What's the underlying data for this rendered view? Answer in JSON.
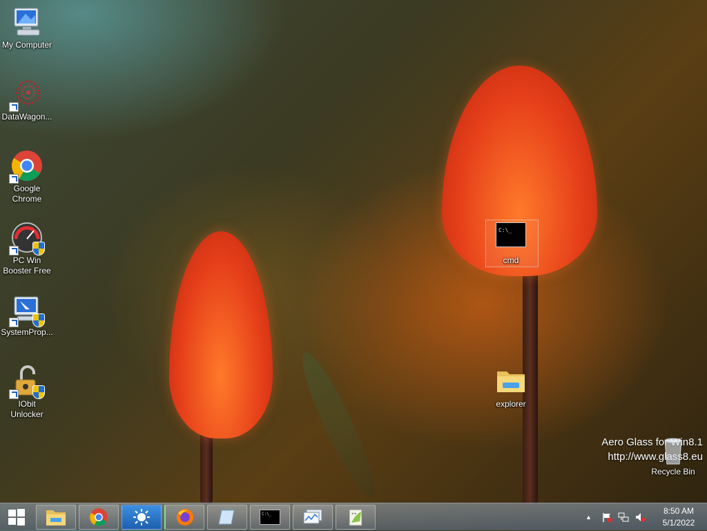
{
  "desktop": {
    "icons": [
      {
        "label_line1": "My Computer",
        "label_line2": ""
      },
      {
        "label_line1": "DataWagon...",
        "label_line2": ""
      },
      {
        "label_line1": "Google",
        "label_line2": "Chrome"
      },
      {
        "label_line1": "PC Win",
        "label_line2": "Booster Free"
      },
      {
        "label_line1": "SystemProp...",
        "label_line2": ""
      },
      {
        "label_line1": "IObit",
        "label_line2": "Unlocker"
      },
      {
        "label_line1": "cmd",
        "label_line2": ""
      },
      {
        "label_line1": "explorer",
        "label_line2": ""
      },
      {
        "label_line1": "Recycle Bin",
        "label_line2": ""
      }
    ],
    "watermark": {
      "line1": "Aero Glass for Win8.1",
      "line2": "http://www.glass8.eu"
    },
    "cmd_prompt_glyph": "C:\\_"
  },
  "taskbar": {
    "buttons": [
      {
        "icon": "file-explorer-icon"
      },
      {
        "icon": "chrome-icon"
      },
      {
        "icon": "brightness-icon"
      },
      {
        "icon": "firefox-icon"
      },
      {
        "icon": "notebook-icon"
      },
      {
        "icon": "cmd-icon"
      },
      {
        "icon": "performance-monitor-icon"
      },
      {
        "icon": "notepad-plus-plus-icon"
      }
    ],
    "tray": {
      "time": "8:50 AM",
      "date": "5/1/2022",
      "overflow_glyph": "▲"
    }
  },
  "colors": {
    "accent_green": "#7ce48c",
    "taskbar": "#7d93aa"
  }
}
